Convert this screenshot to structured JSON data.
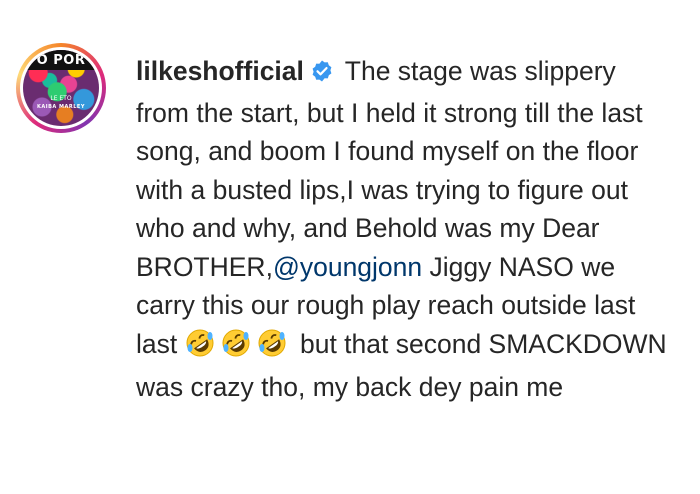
{
  "avatar": {
    "top_text": "O POR",
    "mid_text": "LE ETO",
    "sub_text": "KAIBA MARLEY",
    "ring_colors": [
      "#f58529",
      "#dd2a7b",
      "#8134af",
      "#feda77"
    ]
  },
  "post": {
    "username": "lilkeshofficial",
    "verified_icon": "verified-badge-icon",
    "caption_part1": " The stage was slippery from the start, but I held it strong till the last song, and boom I found myself on the floor with a busted lips,I was trying to figure out who and why, and Behold was my Dear BROTHER,",
    "mention": "@youngjonn",
    "caption_part2": " Jiggy NASO we carry this our rough play reach outside last last ",
    "emojis": [
      "rolling-on-floor-laughing-icon",
      "rolling-on-floor-laughing-icon",
      "rolling-on-floor-laughing-icon"
    ],
    "caption_part3": " but that second SMACKDOWN was crazy tho, my back dey pain me"
  },
  "colors": {
    "text": "#262626",
    "mention": "#00376b",
    "verified": "#3897f0"
  }
}
